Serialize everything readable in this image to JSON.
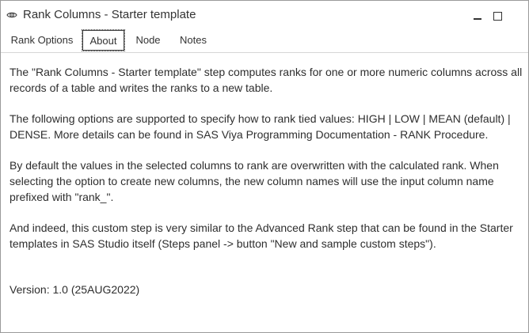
{
  "window": {
    "title": "Rank Columns - Starter template"
  },
  "tabs": [
    {
      "label": "Rank Options"
    },
    {
      "label": "About"
    },
    {
      "label": "Node"
    },
    {
      "label": "Notes"
    }
  ],
  "active_tab": "About",
  "about": {
    "paragraph_1": "The \"Rank Columns - Starter template\" step computes ranks for one or more numeric columns across all records of a table and writes the ranks to a new table.",
    "paragraph_2": "The following options are supported to specify how to rank tied values: HIGH | LOW | MEAN (default) | DENSE. More details can be found in SAS Viya Programming Documentation - RANK Procedure.",
    "paragraph_3": "By default the values in the selected columns to rank are overwritten with the calculated rank. When selecting the option to create new columns, the new column names will use the input column name prefixed with \"rank_\".",
    "paragraph_4": "And indeed, this custom step is very similar to the Advanced Rank step that can be found in the Starter templates in SAS Studio itself (Steps panel ->  button \"New and sample custom steps\").",
    "version": "Version: 1.0 (25AUG2022)"
  },
  "icons": {
    "title_icon": "eye-settings-icon",
    "minimize": "minimize-icon",
    "maximize": "maximize-icon"
  }
}
